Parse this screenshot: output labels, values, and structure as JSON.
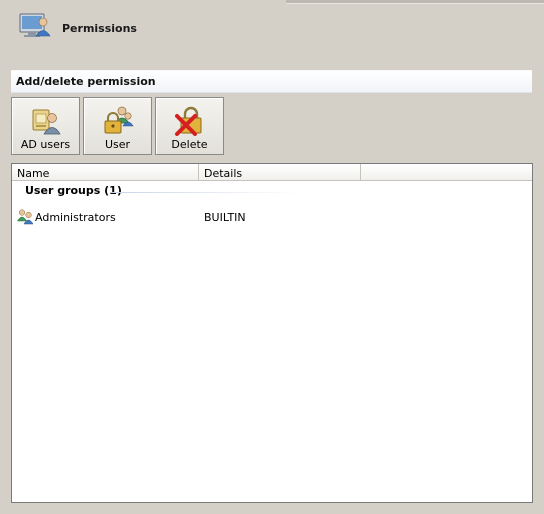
{
  "header": {
    "title": "Permissions",
    "icon": "computer-users-icon"
  },
  "section": {
    "title": "Add/delete permission"
  },
  "toolbar": {
    "ad_users_label": "AD users",
    "user_label": "User",
    "delete_label": "Delete"
  },
  "list": {
    "columns": [
      "Name",
      "Details",
      ""
    ],
    "group": {
      "label": "User groups (1)"
    },
    "rows": [
      {
        "name": "Administrators",
        "details": "BUILTIN",
        "icon": "user-group-icon"
      }
    ]
  },
  "colors": {
    "window_bg": "#d4d0c8",
    "section_bar": "#f1f4f8",
    "list_bg": "#ffffff",
    "delete_x": "#d42020"
  }
}
